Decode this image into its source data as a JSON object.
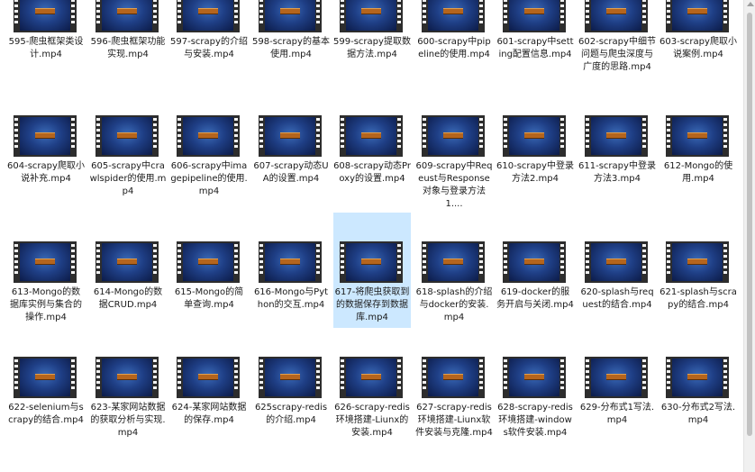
{
  "files": [
    {
      "label": "595-爬虫框架类设计.mp4"
    },
    {
      "label": "596-爬虫框架功能实现.mp4"
    },
    {
      "label": "597-scrapy的介绍与安装.mp4"
    },
    {
      "label": "598-scrapy的基本使用.mp4"
    },
    {
      "label": "599-scrapy提取数据方法.mp4"
    },
    {
      "label": "600-scrapy中pipeline的使用.mp4"
    },
    {
      "label": "601-scrapy中setting配置信息.mp4"
    },
    {
      "label": "602-scrapy中细节问题与爬虫深度与广度的思路.mp4"
    },
    {
      "label": "603-scrapy爬取小说案例.mp4"
    },
    {
      "label": "604-scrapy爬取小说补充.mp4"
    },
    {
      "label": "605-scrapy中crawlspider的使用.mp4"
    },
    {
      "label": "606-scrapy中imagepipeline的使用.mp4"
    },
    {
      "label": "607-scrapy动态UA的设置.mp4"
    },
    {
      "label": "608-scrapy动态Proxy的设置.mp4"
    },
    {
      "label": "609-scrapy中Reqeust与Response对象与登录方法1...."
    },
    {
      "label": "610-scrapy中登录方法2.mp4"
    },
    {
      "label": "611-scrapy中登录方法3.mp4"
    },
    {
      "label": "612-Mongo的使用.mp4"
    },
    {
      "label": "613-Mongo的数据库实例与集合的操作.mp4"
    },
    {
      "label": "614-Mongo的数据CRUD.mp4"
    },
    {
      "label": "615-Mongo的简单查询.mp4"
    },
    {
      "label": "616-Mongo与Python的交互.mp4"
    },
    {
      "label": "617-将爬虫获取到的数据保存到数据库.mp4"
    },
    {
      "label": "618-splash的介绍与docker的安装.mp4"
    },
    {
      "label": "619-docker的服务开启与关闭.mp4"
    },
    {
      "label": "620-splash与request的结合.mp4"
    },
    {
      "label": "621-splash与scrapy的结合.mp4"
    },
    {
      "label": "622-selenium与scrapy的结合.mp4"
    },
    {
      "label": "623-某家网站数据的获取分析与实现.mp4"
    },
    {
      "label": "624-某家网站数据的保存.mp4"
    },
    {
      "label": "625scrapy-redis的介绍.mp4"
    },
    {
      "label": "626-scrapy-redis环境搭建-Liunx的安装.mp4"
    },
    {
      "label": "627-scrapy-redis环境搭建-Liunx软件安装与克隆.mp4"
    },
    {
      "label": "628-scrapy-redis环境搭建-windows软件安装.mp4"
    },
    {
      "label": "629-分布式1写法.mp4"
    },
    {
      "label": "630-分布式2写法.mp4"
    }
  ],
  "selected_label": "617-将爬虫获取到的数据保存到数据库.mp4"
}
